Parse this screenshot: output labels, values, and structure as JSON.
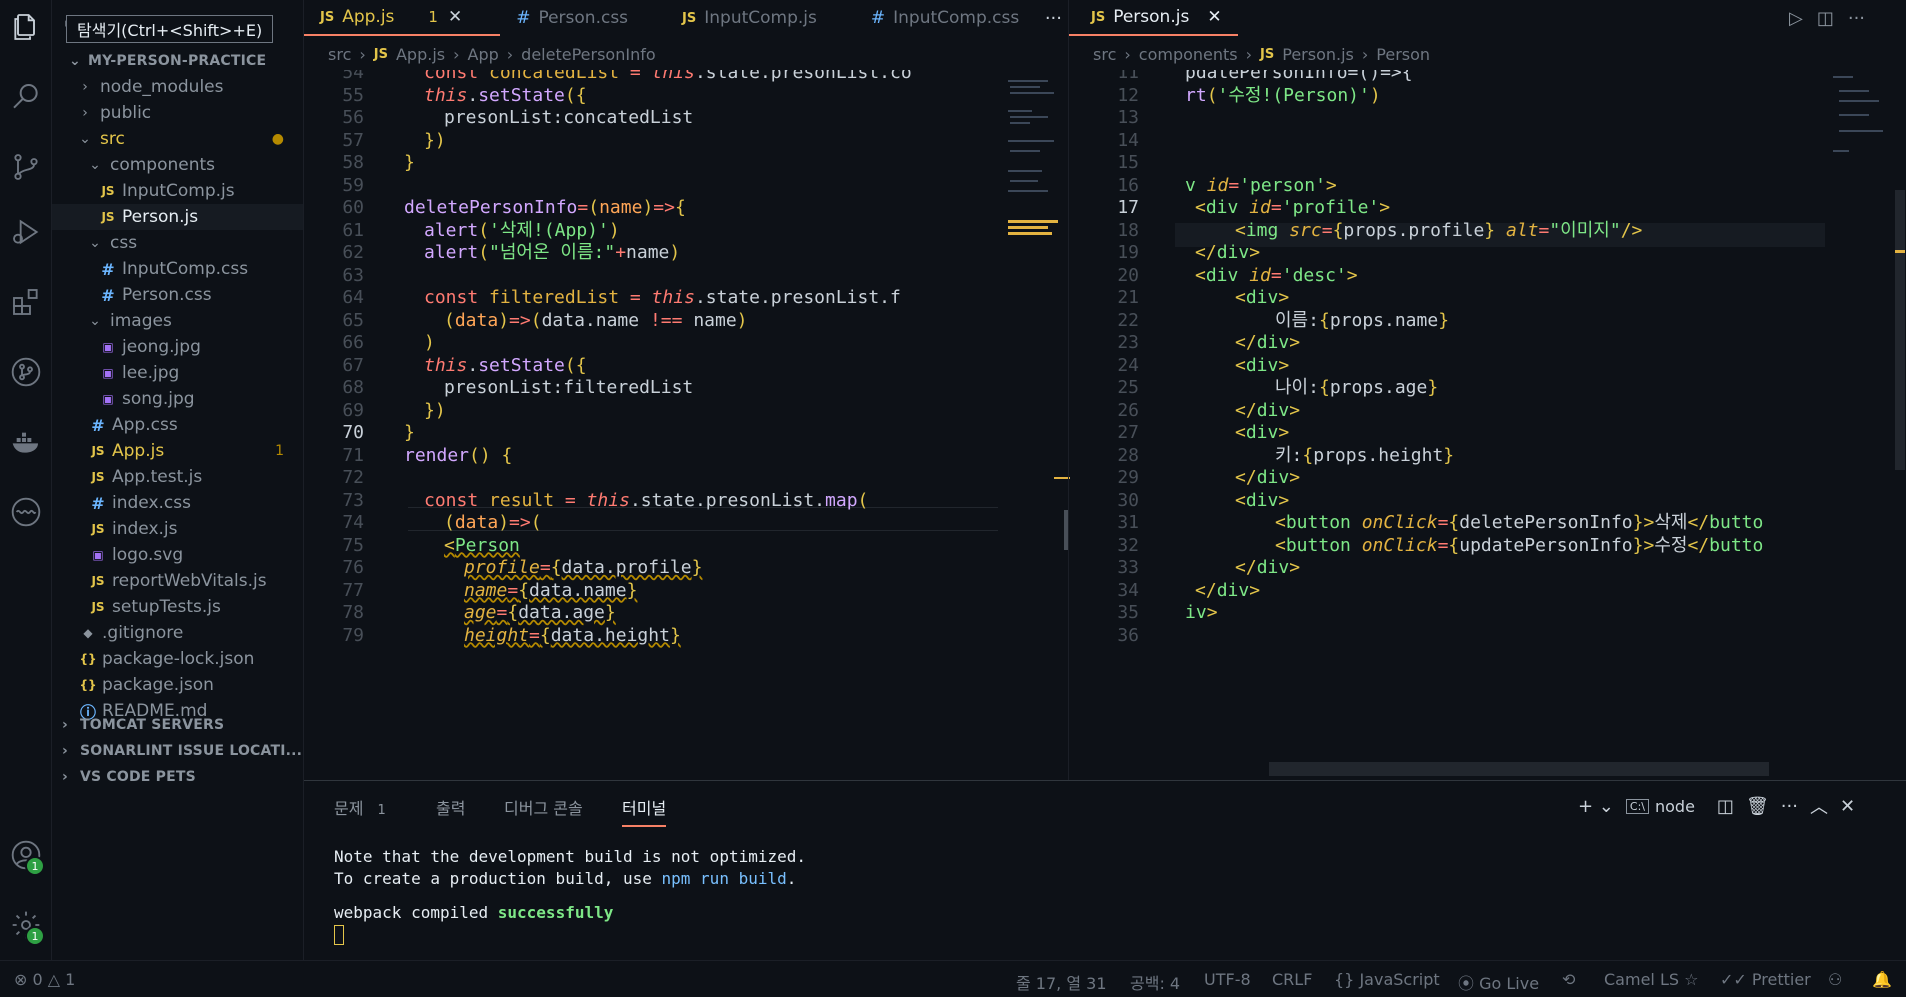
{
  "tooltip": "탐색기(Ctrl+<Shift>+E)",
  "sidebar": {
    "project": "MY-PERSON-PRACTICE",
    "tree": [
      {
        "label": "node_modules",
        "type": "folder",
        "depth": 1,
        "open": false
      },
      {
        "label": "public",
        "type": "folder",
        "depth": 1,
        "open": false
      },
      {
        "label": "src",
        "type": "folder",
        "depth": 1,
        "open": true,
        "mark": "●"
      },
      {
        "label": "components",
        "type": "folder",
        "depth": 2,
        "open": true
      },
      {
        "label": "InputComp.js",
        "type": "js",
        "depth": 3
      },
      {
        "label": "Person.js",
        "type": "js",
        "depth": 3,
        "selected": true
      },
      {
        "label": "css",
        "type": "folder",
        "depth": 2,
        "open": true
      },
      {
        "label": "InputComp.css",
        "type": "css",
        "depth": 3
      },
      {
        "label": "Person.css",
        "type": "css",
        "depth": 3
      },
      {
        "label": "images",
        "type": "folder",
        "depth": 2,
        "open": true
      },
      {
        "label": "jeong.jpg",
        "type": "img",
        "depth": 3
      },
      {
        "label": "lee.jpg",
        "type": "img",
        "depth": 3
      },
      {
        "label": "song.jpg",
        "type": "img",
        "depth": 3
      },
      {
        "label": "App.css",
        "type": "css",
        "depth": 2
      },
      {
        "label": "App.js",
        "type": "js",
        "depth": 2,
        "mark": "1",
        "warn": true
      },
      {
        "label": "App.test.js",
        "type": "js",
        "depth": 2
      },
      {
        "label": "index.css",
        "type": "css",
        "depth": 2
      },
      {
        "label": "index.js",
        "type": "js",
        "depth": 2
      },
      {
        "label": "logo.svg",
        "type": "img",
        "depth": 2
      },
      {
        "label": "reportWebVitals.js",
        "type": "js",
        "depth": 2
      },
      {
        "label": "setupTests.js",
        "type": "js",
        "depth": 2
      },
      {
        "label": ".gitignore",
        "type": "git",
        "depth": 1
      },
      {
        "label": "package-lock.json",
        "type": "json",
        "depth": 1
      },
      {
        "label": "package.json",
        "type": "json",
        "depth": 1
      },
      {
        "label": "README.md",
        "type": "info",
        "depth": 1
      }
    ],
    "sections": [
      "TOMCAT SERVERS",
      "SONARLINT ISSUE LOCATI...",
      "VS CODE PETS"
    ]
  },
  "left_editor": {
    "tabs": [
      {
        "label": "App.js",
        "kind": "JS",
        "badge": "1",
        "active": true,
        "close": "✕"
      },
      {
        "label": "Person.css",
        "kind": "#"
      },
      {
        "label": "InputComp.js",
        "kind": "JS"
      },
      {
        "label": "InputComp.css",
        "kind": "#"
      }
    ],
    "more": "···",
    "breadcrumb": [
      "src",
      "›",
      "JS",
      "App.js",
      "›",
      "App",
      "›",
      "deletePersonInfo"
    ]
  },
  "right_editor": {
    "tab": {
      "label": "Person.js",
      "kind": "JS",
      "close": "✕"
    },
    "breadcrumb": [
      "src",
      "›",
      "components",
      "›",
      "JS",
      "Person.js",
      "›",
      "Person"
    ]
  },
  "left_lines": [
    54,
    55,
    56,
    57,
    58,
    59,
    60,
    61,
    62,
    63,
    64,
    65,
    66,
    67,
    68,
    69,
    70,
    71,
    72,
    73,
    74,
    75,
    76,
    77,
    78,
    79
  ],
  "right_lines": [
    11,
    12,
    13,
    14,
    15,
    16,
    17,
    18,
    19,
    20,
    21,
    22,
    23,
    24,
    25,
    26,
    27,
    28,
    29,
    30,
    31,
    32,
    33,
    34,
    35,
    36
  ],
  "panel": {
    "tabs": [
      {
        "label": "문제",
        "count": "1"
      },
      {
        "label": "출력"
      },
      {
        "label": "디버그 콘솔"
      },
      {
        "label": "터미널",
        "active": true
      }
    ],
    "terminal_name": "node",
    "lines": [
      "Note that the development build is not optimized.",
      "To create a production build, use ",
      "npm run build",
      ".",
      "webpack compiled ",
      "successfully"
    ]
  },
  "status": {
    "errors": "0",
    "warnings": "1",
    "position": "줄 17, 열 31",
    "indent": "공백: 4",
    "encoding": "UTF-8",
    "eol": "CRLF",
    "language": "JavaScript",
    "golive": "Go Live",
    "camel": "Camel LS",
    "prettier": "Prettier"
  },
  "colors": {
    "bg": "#0d1117",
    "accent": "#f78166",
    "badge": "#2ea043"
  }
}
